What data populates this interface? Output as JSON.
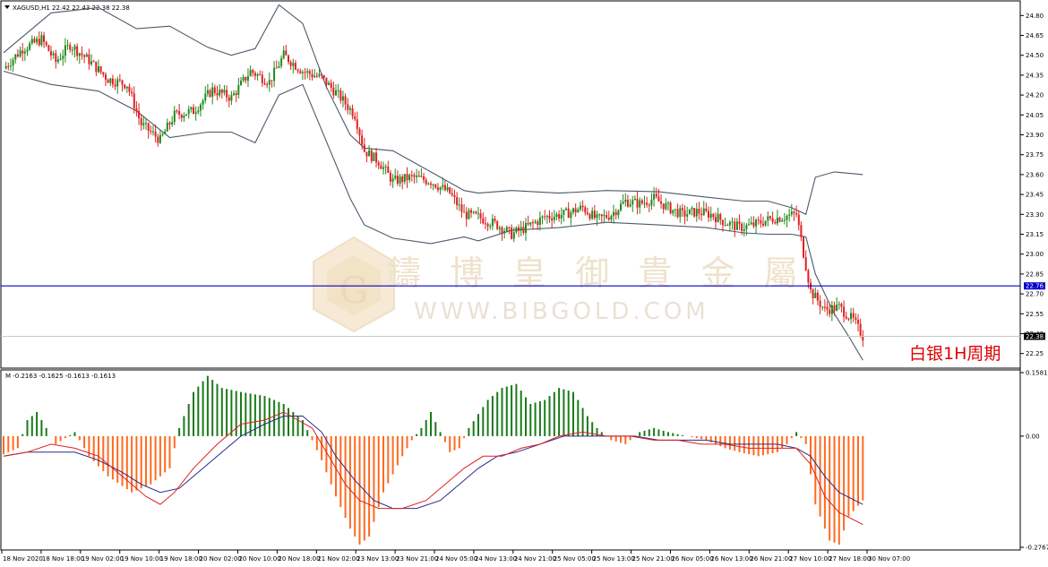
{
  "colors": {
    "up": "#1e8a1e",
    "down": "#e02020",
    "band": "#4a5a6a",
    "hline": "#0000cc",
    "hist_pos": "#1a7a1a",
    "hist_neg": "#ff6a20",
    "macd_line": "#e02020",
    "signal_line": "#2a2a8a"
  },
  "header": {
    "main": "XAGUSD,H1  22.42 22.43 22.38 22.38",
    "sub": "M -0.2163 -0.1625 -0.1613 -0.1613"
  },
  "watermark": {
    "cn": "鑄 博 皇 御 貴 金 屬",
    "en": "WWW.BIBGOLD.COM"
  },
  "annotation": "白银1H周期",
  "price_tags": {
    "blue_line": "22.76",
    "last": "22.38"
  },
  "chart_data": [
    {
      "type": "candlestick",
      "symbol": "XAGUSD",
      "timeframe": "H1",
      "ohlc_header": {
        "open": 22.42,
        "high": 22.43,
        "low": 22.38,
        "close": 22.38
      },
      "ylim": [
        22.16,
        24.89
      ],
      "yticks": [
        "24.80",
        "24.65",
        "24.50",
        "24.35",
        "24.20",
        "24.05",
        "23.90",
        "23.75",
        "23.60",
        "23.45",
        "23.30",
        "23.15",
        "23.00",
        "22.85",
        "22.70",
        "22.55",
        "22.40",
        "22.25"
      ],
      "horizontal_line": 22.76,
      "last_price": 22.38,
      "xticks": [
        "18 Nov 2020",
        "18 Nov 18:00",
        "19 Nov 02:00",
        "19 Nov 10:00",
        "19 Nov 18:00",
        "20 Nov 02:00",
        "20 Nov 10:00",
        "20 Nov 18:00",
        "21 Nov 02:00",
        "23 Nov 13:00",
        "23 Nov 21:00",
        "24 Nov 05:00",
        "24 Nov 13:00",
        "24 Nov 21:00",
        "25 Nov 05:00",
        "25 Nov 13:00",
        "25 Nov 21:00",
        "26 Nov 05:00",
        "26 Nov 13:00",
        "26 Nov 21:00",
        "27 Nov 10:00",
        "27 Nov 18:00",
        "30 Nov 07:00"
      ],
      "indicator": "Bollinger Bands",
      "close_path": [
        [
          0,
          24.4
        ],
        [
          8,
          24.55
        ],
        [
          16,
          24.62
        ],
        [
          22,
          24.45
        ],
        [
          28,
          24.58
        ],
        [
          36,
          24.46
        ],
        [
          44,
          24.32
        ],
        [
          52,
          24.28
        ],
        [
          58,
          23.98
        ],
        [
          66,
          23.86
        ],
        [
          72,
          24.05
        ],
        [
          80,
          24.08
        ],
        [
          88,
          24.24
        ],
        [
          96,
          24.18
        ],
        [
          104,
          24.38
        ],
        [
          112,
          24.3
        ],
        [
          118,
          24.5
        ],
        [
          126,
          24.38
        ],
        [
          134,
          24.33
        ],
        [
          142,
          24.18
        ],
        [
          148,
          24.05
        ],
        [
          152,
          23.78
        ],
        [
          158,
          23.7
        ],
        [
          164,
          23.55
        ],
        [
          172,
          23.58
        ],
        [
          180,
          23.55
        ],
        [
          188,
          23.46
        ],
        [
          194,
          23.3
        ],
        [
          200,
          23.28
        ],
        [
          208,
          23.22
        ],
        [
          214,
          23.15
        ],
        [
          220,
          23.2
        ],
        [
          228,
          23.28
        ],
        [
          236,
          23.3
        ],
        [
          244,
          23.35
        ],
        [
          250,
          23.26
        ],
        [
          256,
          23.3
        ],
        [
          262,
          23.4
        ],
        [
          268,
          23.38
        ],
        [
          274,
          23.42
        ],
        [
          280,
          23.35
        ],
        [
          286,
          23.3
        ],
        [
          292,
          23.32
        ],
        [
          298,
          23.3
        ],
        [
          304,
          23.24
        ],
        [
          310,
          23.2
        ],
        [
          316,
          23.22
        ],
        [
          322,
          23.26
        ],
        [
          328,
          23.28
        ],
        [
          334,
          23.3
        ],
        [
          340,
          22.72
        ],
        [
          346,
          22.58
        ],
        [
          352,
          22.6
        ],
        [
          358,
          22.5
        ],
        [
          362,
          22.38
        ]
      ],
      "upper_band": [
        [
          0,
          24.52
        ],
        [
          20,
          24.82
        ],
        [
          40,
          24.86
        ],
        [
          56,
          24.7
        ],
        [
          70,
          24.72
        ],
        [
          86,
          24.56
        ],
        [
          96,
          24.5
        ],
        [
          106,
          24.55
        ],
        [
          116,
          24.88
        ],
        [
          126,
          24.74
        ],
        [
          136,
          24.26
        ],
        [
          146,
          23.9
        ],
        [
          152,
          23.8
        ],
        [
          164,
          23.78
        ],
        [
          180,
          23.62
        ],
        [
          194,
          23.48
        ],
        [
          200,
          23.46
        ],
        [
          214,
          23.48
        ],
        [
          234,
          23.46
        ],
        [
          254,
          23.48
        ],
        [
          276,
          23.47
        ],
        [
          296,
          23.43
        ],
        [
          312,
          23.4
        ],
        [
          322,
          23.4
        ],
        [
          332,
          23.35
        ],
        [
          338,
          23.3
        ],
        [
          342,
          23.58
        ],
        [
          350,
          23.62
        ],
        [
          362,
          23.6
        ]
      ],
      "lower_band": [
        [
          0,
          24.38
        ],
        [
          20,
          24.28
        ],
        [
          40,
          24.23
        ],
        [
          56,
          24.08
        ],
        [
          70,
          23.88
        ],
        [
          86,
          23.92
        ],
        [
          96,
          23.92
        ],
        [
          106,
          23.84
        ],
        [
          116,
          24.2
        ],
        [
          126,
          24.28
        ],
        [
          136,
          23.85
        ],
        [
          146,
          23.42
        ],
        [
          152,
          23.22
        ],
        [
          164,
          23.12
        ],
        [
          180,
          23.08
        ],
        [
          194,
          23.13
        ],
        [
          200,
          23.1
        ],
        [
          214,
          23.18
        ],
        [
          234,
          23.2
        ],
        [
          254,
          23.24
        ],
        [
          276,
          23.22
        ],
        [
          296,
          23.2
        ],
        [
          312,
          23.16
        ],
        [
          322,
          23.15
        ],
        [
          332,
          23.15
        ],
        [
          338,
          23.13
        ],
        [
          342,
          22.85
        ],
        [
          350,
          22.55
        ],
        [
          356,
          22.38
        ],
        [
          362,
          22.2
        ]
      ]
    },
    {
      "type": "bar",
      "indicator": "MACD",
      "values_header": [
        -0.2163,
        -0.1625,
        -0.1613,
        -0.1613
      ],
      "ylim": [
        -0.2767,
        0.1581
      ],
      "yticks": [
        "0.1581",
        "0.00",
        "-0.2767"
      ],
      "histogram": [
        [
          0,
          -0.045
        ],
        [
          6,
          -0.03
        ],
        [
          10,
          0.04
        ],
        [
          14,
          0.06
        ],
        [
          18,
          0.02
        ],
        [
          22,
          -0.02
        ],
        [
          30,
          0.01
        ],
        [
          36,
          -0.05
        ],
        [
          44,
          -0.1
        ],
        [
          54,
          -0.14
        ],
        [
          62,
          -0.12
        ],
        [
          70,
          -0.08
        ],
        [
          74,
          0.02
        ],
        [
          80,
          0.11
        ],
        [
          86,
          0.15
        ],
        [
          92,
          0.12
        ],
        [
          100,
          0.11
        ],
        [
          110,
          0.1
        ],
        [
          118,
          0.08
        ],
        [
          126,
          0.04
        ],
        [
          130,
          -0.01
        ],
        [
          134,
          -0.06
        ],
        [
          140,
          -0.15
        ],
        [
          146,
          -0.23
        ],
        [
          150,
          -0.27
        ],
        [
          154,
          -0.25
        ],
        [
          160,
          -0.14
        ],
        [
          168,
          -0.05
        ],
        [
          172,
          -0.01
        ],
        [
          176,
          0.02
        ],
        [
          180,
          0.06
        ],
        [
          184,
          0.01
        ],
        [
          188,
          -0.04
        ],
        [
          192,
          -0.03
        ],
        [
          196,
          0.02
        ],
        [
          204,
          0.09
        ],
        [
          210,
          0.12
        ],
        [
          216,
          0.13
        ],
        [
          222,
          0.08
        ],
        [
          228,
          0.09
        ],
        [
          234,
          0.12
        ],
        [
          240,
          0.11
        ],
        [
          246,
          0.05
        ],
        [
          250,
          0.02
        ],
        [
          256,
          -0.01
        ],
        [
          262,
          -0.02
        ],
        [
          268,
          0.01
        ],
        [
          274,
          0.02
        ],
        [
          280,
          0.01
        ],
        [
          288,
          0.0
        ],
        [
          296,
          -0.01
        ],
        [
          304,
          -0.03
        ],
        [
          310,
          -0.04
        ],
        [
          318,
          -0.05
        ],
        [
          326,
          -0.04
        ],
        [
          330,
          -0.02
        ],
        [
          334,
          0.01
        ],
        [
          338,
          -0.02
        ],
        [
          342,
          -0.17
        ],
        [
          348,
          -0.26
        ],
        [
          352,
          -0.27
        ],
        [
          356,
          -0.2
        ],
        [
          362,
          -0.16
        ]
      ],
      "macd_line": [
        [
          0,
          -0.05
        ],
        [
          10,
          -0.04
        ],
        [
          20,
          -0.02
        ],
        [
          30,
          -0.03
        ],
        [
          40,
          -0.05
        ],
        [
          50,
          -0.1
        ],
        [
          60,
          -0.15
        ],
        [
          66,
          -0.17
        ],
        [
          72,
          -0.14
        ],
        [
          80,
          -0.08
        ],
        [
          90,
          -0.02
        ],
        [
          100,
          0.03
        ],
        [
          110,
          0.04
        ],
        [
          118,
          0.06
        ],
        [
          124,
          0.04
        ],
        [
          130,
          0.02
        ],
        [
          136,
          -0.04
        ],
        [
          144,
          -0.12
        ],
        [
          150,
          -0.16
        ],
        [
          158,
          -0.18
        ],
        [
          168,
          -0.18
        ],
        [
          178,
          -0.16
        ],
        [
          186,
          -0.12
        ],
        [
          194,
          -0.08
        ],
        [
          202,
          -0.05
        ],
        [
          210,
          -0.05
        ],
        [
          218,
          -0.03
        ],
        [
          226,
          -0.02
        ],
        [
          234,
          0.0
        ],
        [
          244,
          0.01
        ],
        [
          254,
          0.0
        ],
        [
          264,
          0.0
        ],
        [
          274,
          -0.01
        ],
        [
          284,
          -0.01
        ],
        [
          294,
          -0.02
        ],
        [
          304,
          -0.02
        ],
        [
          314,
          -0.03
        ],
        [
          324,
          -0.03
        ],
        [
          334,
          -0.03
        ],
        [
          340,
          -0.07
        ],
        [
          346,
          -0.15
        ],
        [
          352,
          -0.19
        ],
        [
          362,
          -0.22
        ]
      ],
      "signal_line": [
        [
          0,
          -0.05
        ],
        [
          10,
          -0.04
        ],
        [
          20,
          -0.04
        ],
        [
          30,
          -0.04
        ],
        [
          40,
          -0.06
        ],
        [
          50,
          -0.09
        ],
        [
          58,
          -0.12
        ],
        [
          66,
          -0.14
        ],
        [
          74,
          -0.13
        ],
        [
          82,
          -0.09
        ],
        [
          92,
          -0.04
        ],
        [
          100,
          0.0
        ],
        [
          110,
          0.03
        ],
        [
          118,
          0.05
        ],
        [
          126,
          0.05
        ],
        [
          134,
          0.01
        ],
        [
          140,
          -0.05
        ],
        [
          148,
          -0.11
        ],
        [
          156,
          -0.16
        ],
        [
          164,
          -0.18
        ],
        [
          174,
          -0.18
        ],
        [
          184,
          -0.16
        ],
        [
          192,
          -0.12
        ],
        [
          200,
          -0.08
        ],
        [
          208,
          -0.05
        ],
        [
          216,
          -0.04
        ],
        [
          226,
          -0.02
        ],
        [
          236,
          0.0
        ],
        [
          246,
          0.0
        ],
        [
          256,
          0.0
        ],
        [
          266,
          0.0
        ],
        [
          276,
          -0.01
        ],
        [
          286,
          -0.01
        ],
        [
          296,
          -0.01
        ],
        [
          306,
          -0.02
        ],
        [
          316,
          -0.02
        ],
        [
          326,
          -0.02
        ],
        [
          334,
          -0.03
        ],
        [
          340,
          -0.05
        ],
        [
          346,
          -0.1
        ],
        [
          352,
          -0.14
        ],
        [
          362,
          -0.17
        ]
      ]
    }
  ]
}
